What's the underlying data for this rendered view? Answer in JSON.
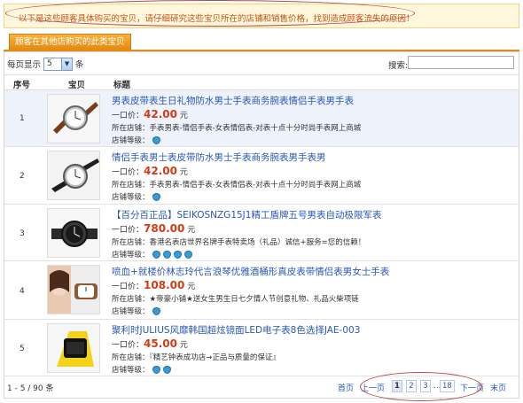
{
  "notice": "以下是这些顾客具体购买的宝贝，请仔细研究这些宝贝所在的店铺和销售价格，找到造成顾客流失的原因！",
  "tab_label": "顾客在其他店购买的此类宝贝",
  "toolbar": {
    "per_page_prefix": "每页显示",
    "per_page_value": "5",
    "per_page_suffix": "条",
    "search_label": "搜索:"
  },
  "columns": {
    "index": "序号",
    "item": "宝贝",
    "title": "标题"
  },
  "rows": [
    {
      "num": "1",
      "title": "男表皮带表生日礼物防水男士手表商务腕表情侣手表男手表",
      "price_label": "一口价：",
      "price": "42.00",
      "unit": "元",
      "shop_label": "所在店铺：",
      "shop": "手表男表-情侣手表-女表情侣表-对表十点十分时尚手表网上商城",
      "level_label": "店铺等级：",
      "gems": 1
    },
    {
      "num": "2",
      "title": "情侣手表男士表皮带防水男士手表商务腕表男手表男",
      "price_label": "一口价：",
      "price": "42.00",
      "unit": "元",
      "shop_label": "所在店铺：",
      "shop": "手表男表-情侣手表-女表情侣表-对表十点十分时尚手表网上商城",
      "level_label": "店铺等级：",
      "gems": 1
    },
    {
      "num": "3",
      "title": "【百分百正品】SEIKOSNZG15J1精工盾牌五号男表自动极限军表",
      "price_label": "一口价：",
      "price": "780.00",
      "unit": "元",
      "shop_label": "所在店铺：",
      "shop": "香港名表店世界名牌手表特卖场（礼品）诚信+服务=您的信赖！",
      "level_label": "店铺等级：",
      "gems": 4
    },
    {
      "num": "4",
      "title": "喷血+就楼价林志玲代言浪琴优雅酒桶形真皮表带情侣表男女士手表",
      "price_label": "一口价：",
      "price": "108.00",
      "unit": "元",
      "shop_label": "所在店铺：",
      "shop": "★帝豪小铺★送女生男生日七夕情人节创意礼物、礼品火柴项链",
      "level_label": "店铺等级：",
      "gems": 1
    },
    {
      "num": "5",
      "title": "聚利时JULIUS风靡韩国超炫镜面LED电子表8色选择JAE-003",
      "price_label": "一口价：",
      "price": "45.00",
      "unit": "元",
      "shop_label": "所在店铺：",
      "shop": "『精艺钟表成功店→正品与质量的保证』",
      "level_label": "店铺等级：",
      "gems": 2
    }
  ],
  "footer": {
    "count": "1 - 5 / 90 条",
    "first": "首页",
    "prev": "上一页",
    "pages": [
      "1",
      "2",
      "3",
      "...",
      "18"
    ],
    "next": "下一页",
    "last": "末页"
  },
  "colors": {
    "accent": "#e38a12",
    "link": "#2a58b8",
    "price": "#d23b16",
    "highlight_row": "#eef2fb",
    "annotation": "#b84a45"
  }
}
